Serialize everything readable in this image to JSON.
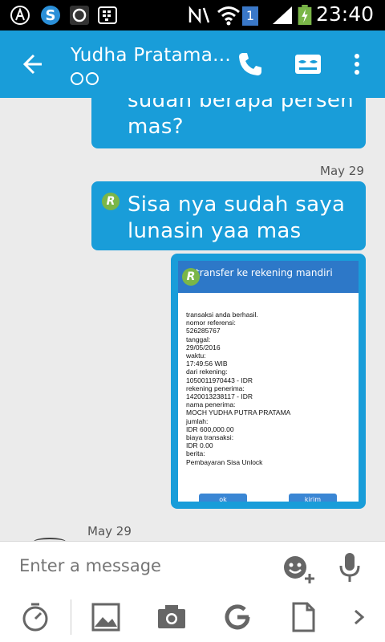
{
  "status_bar": {
    "time": "23:40",
    "sim_badge": "1"
  },
  "header": {
    "contact_name": "Yudha Pratama...",
    "icons": [
      "back-arrow-icon",
      "phone-icon",
      "mask-icon",
      "more-vert-icon"
    ]
  },
  "messages": [
    {
      "kind": "text",
      "text": "sudah berapa persen mas?",
      "line1": "sudah berapa persen",
      "line2": "mas?"
    },
    {
      "kind": "date",
      "text": "May 29"
    },
    {
      "kind": "text",
      "badge": "R",
      "line1": "Sisa nya sudah saya",
      "line2": "lunasin yaa mas"
    },
    {
      "kind": "image",
      "badge": "R",
      "image_title": "transfer ke rekening mandiri",
      "lines": [
        "transaksi anda berhasil.",
        "nomor referensi:",
        "526285767",
        "tanggal:",
        "29/05/2016",
        "waktu:",
        "17:49:56 WIB",
        "dari rekening:",
        "1050011970443 - IDR",
        "rekening penerima:",
        "1420013238117 - IDR",
        "nama penerima:",
        "MOCH YUDHA PUTRA PRATAMA",
        "jumlah:",
        "IDR 600,000.00",
        "biaya transaksi:",
        "IDR 0.00",
        "berita:",
        "Pembayaran Sisa Unlock"
      ],
      "buttons": [
        "ok",
        "kirim"
      ]
    },
    {
      "kind": "date",
      "text": "May 29"
    }
  ],
  "composer": {
    "placeholder": "Enter a message",
    "icons": [
      "emoji-add-icon",
      "mic-icon"
    ],
    "tools": [
      "timer-icon",
      "image-icon",
      "camera-icon",
      "google-icon",
      "file-icon",
      "chevron-right-icon"
    ]
  },
  "colors": {
    "accent": "#199dd9",
    "badge": "#7ab648",
    "background": "#ebebeb"
  }
}
